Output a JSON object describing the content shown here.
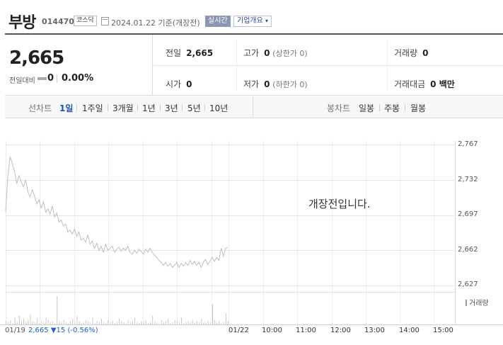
{
  "header": {
    "stock_name": "부방",
    "stock_code": "014470",
    "market": "코스닥",
    "date_text": "2024.01.22 기준(개장전)",
    "realtime_label": "실시간",
    "company_overview_label": "기업개요"
  },
  "summary": {
    "price": "2,665",
    "change_label": "전일대비",
    "change": "0",
    "change_pct": "0.00%",
    "stats": [
      {
        "label": "전일",
        "value": "2,665",
        "sub": ""
      },
      {
        "label": "고가",
        "value": "0",
        "sub": "(상한가 0)"
      },
      {
        "label": "거래량",
        "value": "0",
        "sub": ""
      },
      {
        "label": "시가",
        "value": "0",
        "sub": ""
      },
      {
        "label": "저가",
        "value": "0",
        "sub": "(하한가 0)"
      },
      {
        "label": "거래대금",
        "value": "0 백만",
        "sub": ""
      }
    ]
  },
  "tabs": {
    "line_label": "선차트",
    "line_periods": [
      "1일",
      "1주일",
      "3개월",
      "1년",
      "3년",
      "5년",
      "10년"
    ],
    "active_period": "1일",
    "candle_label": "봉차트",
    "candle_periods": [
      "일봉",
      "주봉",
      "월봉"
    ]
  },
  "chart_data": {
    "type": "line",
    "message": "개장전입니다.",
    "y_ticks": [
      "2,767",
      "2,732",
      "2,697",
      "2,662",
      "2,627"
    ],
    "ylim": [
      2627,
      2767
    ],
    "x_ticks": [
      "01/22",
      "10:00",
      "11:00",
      "12:00",
      "13:00",
      "14:00",
      "15:00"
    ],
    "volume_label": "거래량",
    "prev_day": {
      "date": "01/19",
      "close": "2,665",
      "change": "▼15",
      "change_pct": "(-0.56%)"
    },
    "series": [
      {
        "values": [
          2700,
          2735,
          2755,
          2748,
          2740,
          2728,
          2736,
          2730,
          2725,
          2732,
          2720,
          2715,
          2722,
          2716,
          2708,
          2712,
          2704,
          2710,
          2700,
          2703,
          2698,
          2706,
          2695,
          2699,
          2690,
          2692,
          2686,
          2688,
          2680,
          2682,
          2678,
          2683,
          2676,
          2680,
          2672,
          2674,
          2670,
          2677,
          2668,
          2671,
          2664,
          2669,
          2662,
          2666,
          2660,
          2668,
          2662,
          2664,
          2666,
          2660,
          2663,
          2665,
          2661,
          2664,
          2662,
          2666,
          2660,
          2658,
          2662,
          2659,
          2663,
          2661,
          2658,
          2663,
          2660,
          2664,
          2660,
          2657,
          2655,
          2652,
          2650,
          2647,
          2650,
          2646,
          2649,
          2645,
          2647,
          2650,
          2645,
          2649,
          2646,
          2650,
          2647,
          2652,
          2648,
          2651,
          2647,
          2650,
          2645,
          2650,
          2653,
          2648,
          2651,
          2655,
          2651,
          2655,
          2652,
          2664,
          2656,
          2664,
          2665
        ]
      },
      {
        "volume": [
          3,
          2,
          4,
          1,
          6,
          2,
          8,
          3,
          5,
          2,
          4,
          9,
          3,
          2,
          5,
          1,
          3,
          2,
          6,
          4,
          2,
          3,
          1,
          25,
          3,
          2,
          4,
          2,
          1,
          3,
          5,
          2,
          7,
          3,
          1,
          2,
          4,
          3,
          2,
          6,
          1,
          3,
          2,
          5,
          2,
          1,
          4,
          2,
          3,
          1,
          2,
          5,
          3,
          2,
          1,
          4,
          2,
          3,
          6,
          2,
          1,
          3,
          2,
          4,
          1,
          2,
          8,
          3,
          2,
          1,
          4,
          2,
          3,
          5,
          1,
          2,
          4,
          3,
          2,
          6,
          1,
          2,
          3,
          2,
          4,
          1,
          3,
          2,
          5,
          2,
          1,
          3,
          2,
          18,
          4,
          2,
          3,
          1,
          2,
          10,
          3
        ]
      }
    ]
  }
}
